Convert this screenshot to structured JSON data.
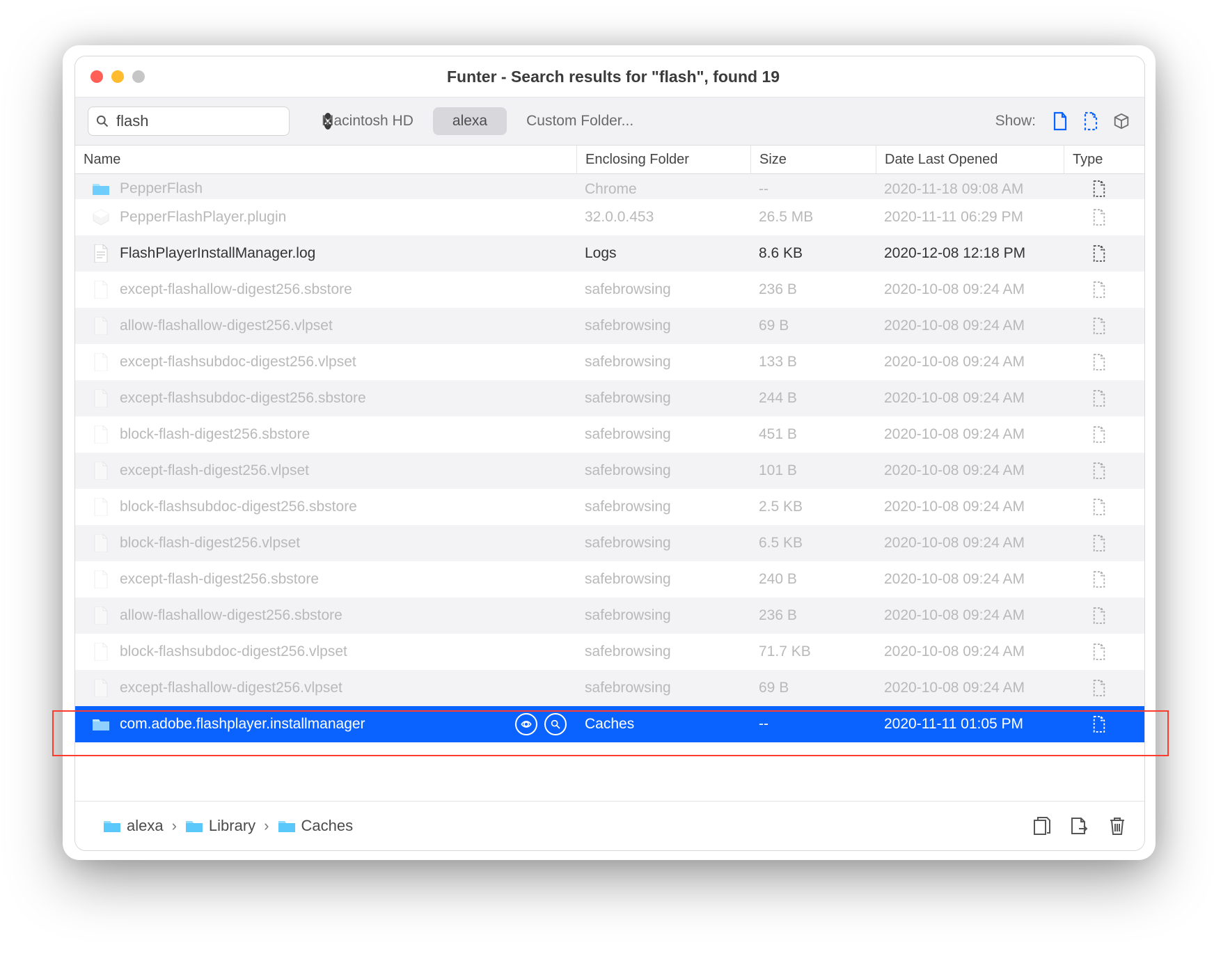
{
  "window": {
    "title": "Funter - Search results for \"flash\", found 19"
  },
  "search": {
    "value": "flash"
  },
  "scopes": {
    "items": [
      "Macintosh HD",
      "alexa",
      "Custom Folder..."
    ],
    "active_index": 1
  },
  "show": {
    "label": "Show:"
  },
  "columns": {
    "name": "Name",
    "enclosing": "Enclosing Folder",
    "size": "Size",
    "date": "Date Last Opened",
    "type": "Type"
  },
  "rows": [
    {
      "icon": "folder",
      "name": "PepperFlash",
      "enclosing": "Chrome",
      "size": "--",
      "date": "2020-11-18 09:08 AM",
      "cutoff": true
    },
    {
      "icon": "plugin",
      "name": "PepperFlashPlayer.plugin",
      "enclosing": "32.0.0.453",
      "size": "26.5 MB",
      "date": "2020-11-11 06:29 PM",
      "dim": true
    },
    {
      "icon": "textfile",
      "name": "FlashPlayerInstallManager.log",
      "enclosing": "Logs",
      "size": "8.6 KB",
      "date": "2020-12-08 12:18 PM"
    },
    {
      "icon": "file",
      "name": "except-flashallow-digest256.sbstore",
      "enclosing": "safebrowsing",
      "size": "236 B",
      "date": "2020-10-08 09:24 AM",
      "dim": true
    },
    {
      "icon": "file",
      "name": "allow-flashallow-digest256.vlpset",
      "enclosing": "safebrowsing",
      "size": "69 B",
      "date": "2020-10-08 09:24 AM",
      "dim": true
    },
    {
      "icon": "file",
      "name": "except-flashsubdoc-digest256.vlpset",
      "enclosing": "safebrowsing",
      "size": "133 B",
      "date": "2020-10-08 09:24 AM",
      "dim": true
    },
    {
      "icon": "file",
      "name": "except-flashsubdoc-digest256.sbstore",
      "enclosing": "safebrowsing",
      "size": "244 B",
      "date": "2020-10-08 09:24 AM",
      "dim": true
    },
    {
      "icon": "file",
      "name": "block-flash-digest256.sbstore",
      "enclosing": "safebrowsing",
      "size": "451 B",
      "date": "2020-10-08 09:24 AM",
      "dim": true
    },
    {
      "icon": "file",
      "name": "except-flash-digest256.vlpset",
      "enclosing": "safebrowsing",
      "size": "101 B",
      "date": "2020-10-08 09:24 AM",
      "dim": true
    },
    {
      "icon": "file",
      "name": "block-flashsubdoc-digest256.sbstore",
      "enclosing": "safebrowsing",
      "size": "2.5 KB",
      "date": "2020-10-08 09:24 AM",
      "dim": true
    },
    {
      "icon": "file",
      "name": "block-flash-digest256.vlpset",
      "enclosing": "safebrowsing",
      "size": "6.5 KB",
      "date": "2020-10-08 09:24 AM",
      "dim": true
    },
    {
      "icon": "file",
      "name": "except-flash-digest256.sbstore",
      "enclosing": "safebrowsing",
      "size": "240 B",
      "date": "2020-10-08 09:24 AM",
      "dim": true
    },
    {
      "icon": "file",
      "name": "allow-flashallow-digest256.sbstore",
      "enclosing": "safebrowsing",
      "size": "236 B",
      "date": "2020-10-08 09:24 AM",
      "dim": true
    },
    {
      "icon": "file",
      "name": "block-flashsubdoc-digest256.vlpset",
      "enclosing": "safebrowsing",
      "size": "71.7 KB",
      "date": "2020-10-08 09:24 AM",
      "dim": true
    },
    {
      "icon": "file",
      "name": "except-flashallow-digest256.vlpset",
      "enclosing": "safebrowsing",
      "size": "69 B",
      "date": "2020-10-08 09:24 AM",
      "dim": true
    },
    {
      "icon": "folder-blue",
      "name": "com.adobe.flashplayer.installmanager",
      "enclosing": "Caches",
      "size": "--",
      "date": "2020-11-11 01:05 PM",
      "selected": true
    }
  ],
  "path": {
    "segments": [
      "alexa",
      "Library",
      "Caches"
    ]
  },
  "colors": {
    "accent": "#0a63ff",
    "highlight": "#ff3b30",
    "folder": "#5ac8fa"
  }
}
